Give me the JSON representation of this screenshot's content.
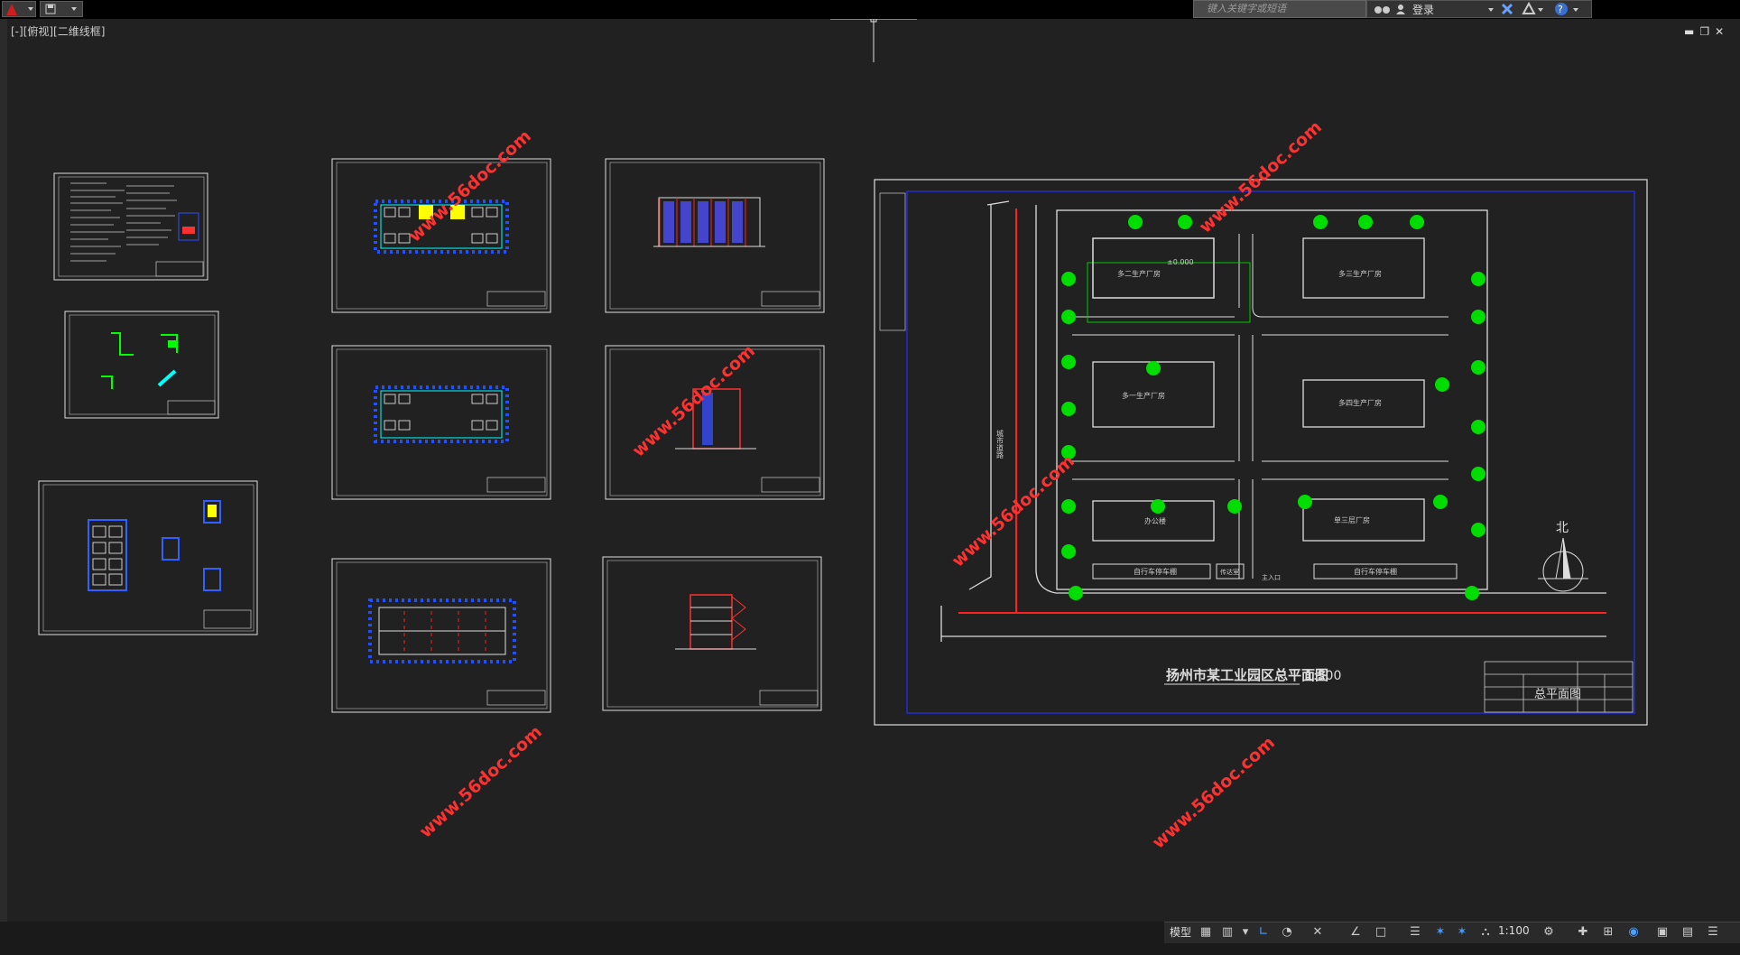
{
  "quick_access": {
    "app_icon": "autocad-a-icon",
    "save_icon": "save-icon"
  },
  "search": {
    "placeholder": "键入关键字或短语"
  },
  "account": {
    "login_label": "登录"
  },
  "viewport": {
    "label": "[-][俯视][二维线框]"
  },
  "watermark": {
    "text": "www.56doc.com"
  },
  "site_plan": {
    "title": "扬州市某工业园区总平面图",
    "scale": "1:500",
    "road_label": "城市道路",
    "north_label": "北",
    "title_block_name": "总平面图",
    "buildings": [
      "多二生产厂房",
      "多三生产厂房",
      "多一生产厂房",
      "多四生产厂房",
      "办公楼",
      "单三层厂房"
    ],
    "parking_1": "自行车停车棚",
    "parking_2": "自行车停车棚",
    "guard": "传达室",
    "entrance": "主入口",
    "level_mark": "±0.000"
  },
  "status": {
    "model": "模型",
    "scale": "1:100"
  },
  "colors": {
    "background": "#212121",
    "frame": "#ffffff",
    "blue_frame": "#0000ff",
    "accent_red": "#ff0000",
    "tree": "#00cc00",
    "grid_yellow": "#ffff00"
  }
}
